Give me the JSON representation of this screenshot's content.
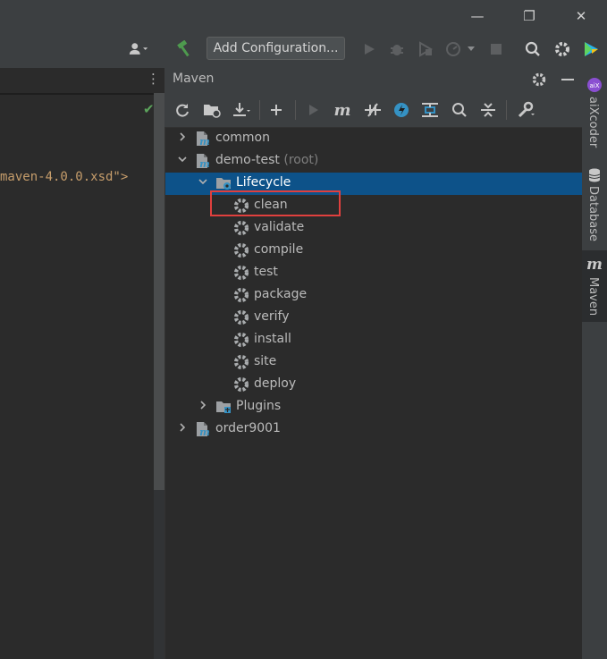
{
  "window": {
    "minimize": "—",
    "restore": "❐",
    "close": "✕"
  },
  "toolbar": {
    "add_configuration_label": "Add Configuration..."
  },
  "editor": {
    "code_fragment": "maven-4.0.0.xsd\">"
  },
  "maven": {
    "title": "Maven",
    "tree": [
      {
        "label": "common",
        "type": "module",
        "expanded": false
      },
      {
        "label": "demo-test",
        "sub": "(root)",
        "type": "module",
        "expanded": true
      },
      {
        "label": "Lifecycle",
        "type": "folder",
        "expanded": true,
        "selected": true
      },
      {
        "label": "clean",
        "type": "goal"
      },
      {
        "label": "validate",
        "type": "goal"
      },
      {
        "label": "compile",
        "type": "goal"
      },
      {
        "label": "test",
        "type": "goal"
      },
      {
        "label": "package",
        "type": "goal"
      },
      {
        "label": "verify",
        "type": "goal"
      },
      {
        "label": "install",
        "type": "goal"
      },
      {
        "label": "site",
        "type": "goal"
      },
      {
        "label": "deploy",
        "type": "goal"
      },
      {
        "label": "Plugins",
        "type": "folder",
        "expanded": false
      },
      {
        "label": "order9001",
        "type": "module",
        "expanded": false
      }
    ]
  },
  "rail": {
    "aixcoder": "aiXcoder",
    "database": "Database",
    "maven": "Maven"
  },
  "colors": {
    "selection": "#0d5289",
    "highlight_border": "#e0403e",
    "maven_blue": "#3592c4",
    "build_green": "#4e9a4e"
  }
}
